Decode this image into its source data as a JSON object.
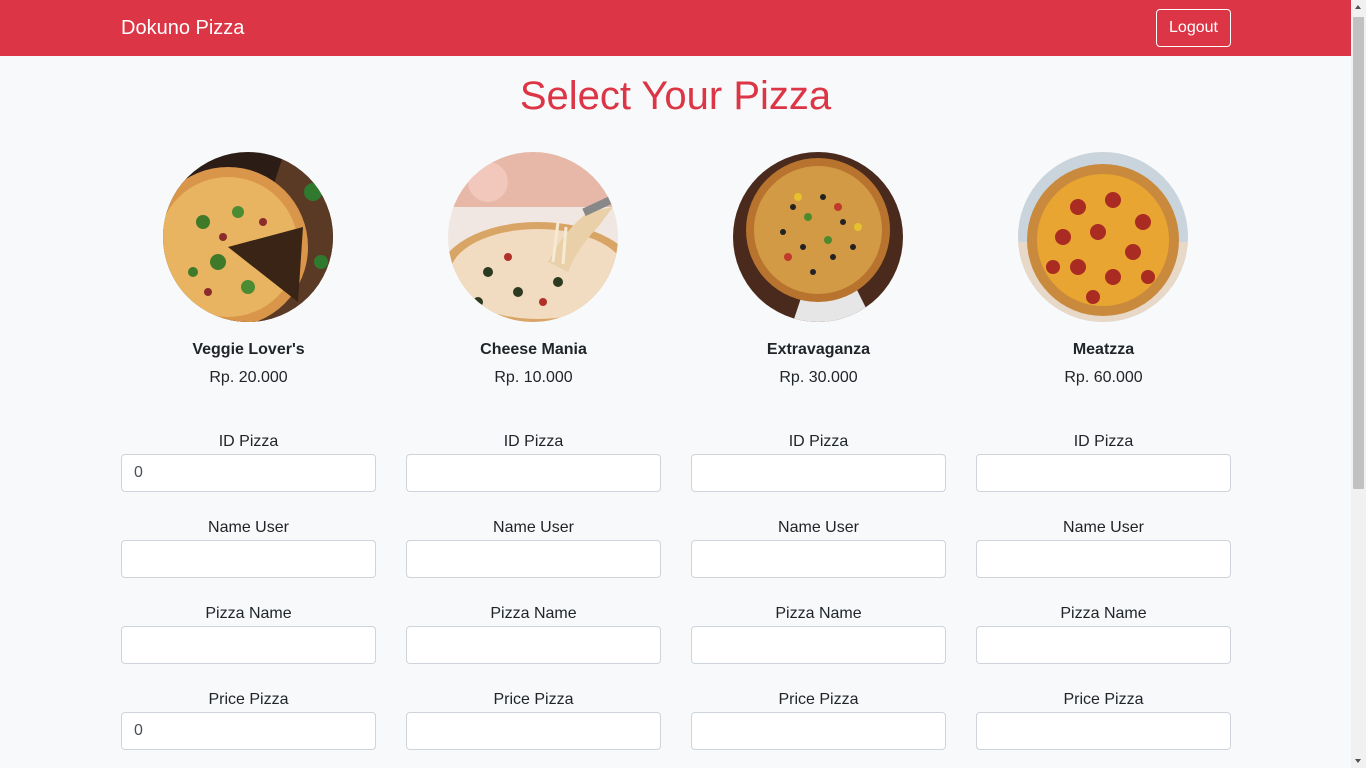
{
  "navbar": {
    "brand": "Dokuno Pizza",
    "logout_label": "Logout"
  },
  "page": {
    "title": "Select Your Pizza"
  },
  "labels": {
    "id_pizza": "ID Pizza",
    "name_user": "Name User",
    "pizza_name": "Pizza Name",
    "price_pizza": "Price Pizza"
  },
  "pizzas": [
    {
      "name": "Veggie Lover's",
      "price": "Rp. 20.000",
      "form": {
        "id_pizza": "0",
        "name_user": "",
        "pizza_name": "",
        "price_pizza": "0"
      }
    },
    {
      "name": "Cheese Mania",
      "price": "Rp. 10.000",
      "form": {
        "id_pizza": "",
        "name_user": "",
        "pizza_name": "",
        "price_pizza": ""
      }
    },
    {
      "name": "Extravaganza",
      "price": "Rp. 30.000",
      "form": {
        "id_pizza": "",
        "name_user": "",
        "pizza_name": "",
        "price_pizza": ""
      }
    },
    {
      "name": "Meatzza",
      "price": "Rp. 60.000",
      "form": {
        "id_pizza": "",
        "name_user": "",
        "pizza_name": "",
        "price_pizza": ""
      }
    }
  ],
  "colors": {
    "brand": "#dc3545",
    "background": "#f8f9fa",
    "input_border": "#ced4da"
  }
}
